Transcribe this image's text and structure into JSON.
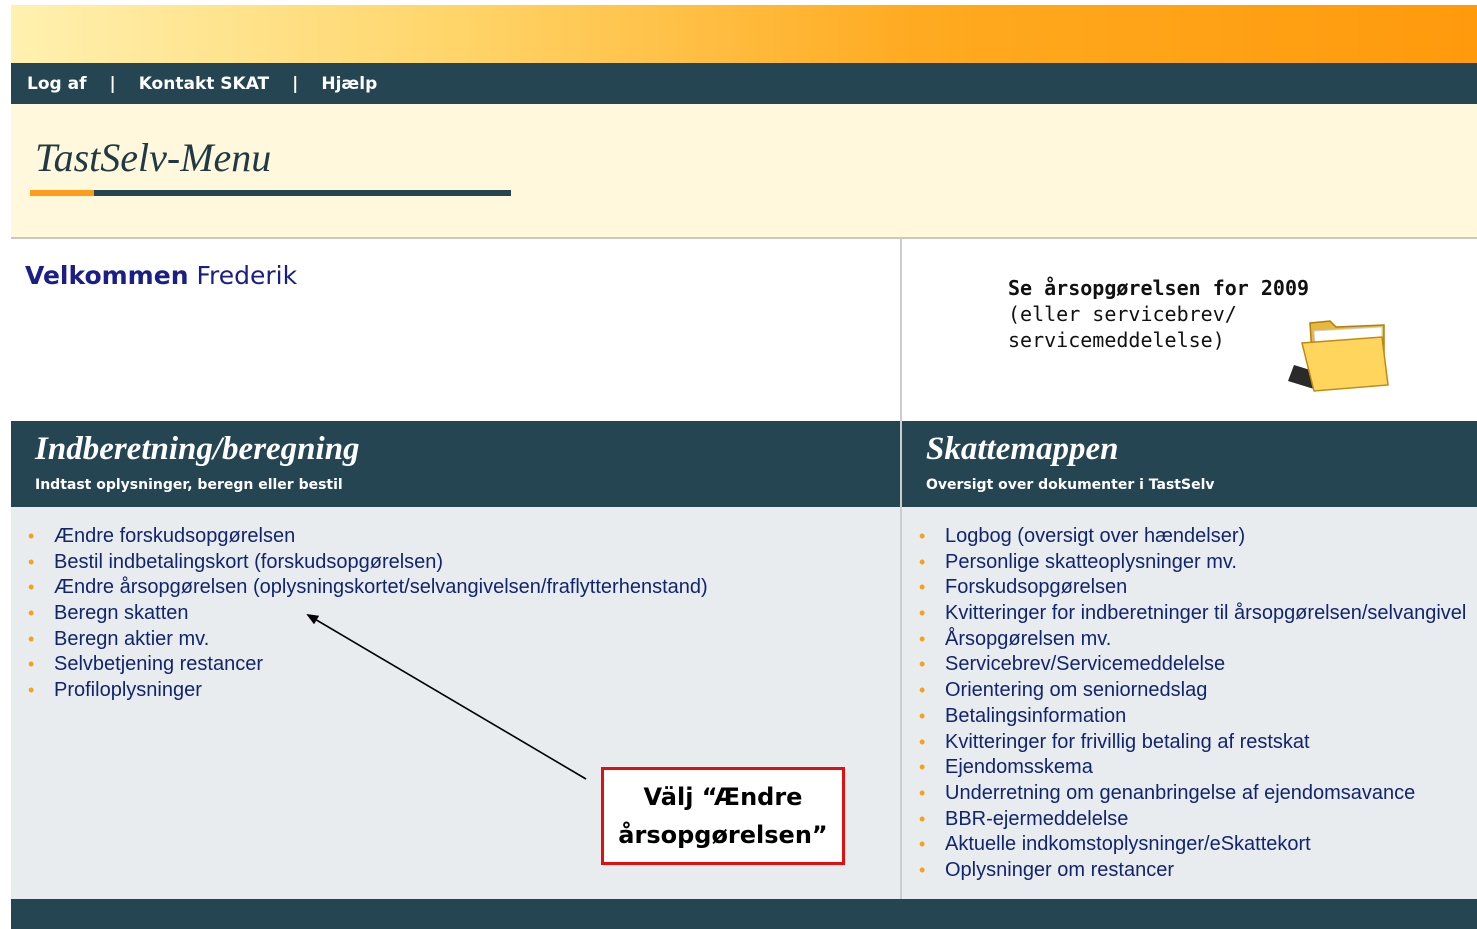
{
  "nav": {
    "logout": "Log af",
    "contact": "Kontakt SKAT",
    "help": "Hjælp",
    "separator": "|"
  },
  "header": {
    "title": "TastSelv-Menu"
  },
  "welcome": {
    "greeting": "Velkommen",
    "name": "Frederik"
  },
  "annual_statement": {
    "line1": "Se årsopgørelsen for 2009",
    "line2": "(eller servicebrev/",
    "line3": "servicemeddelelse)",
    "icon": "folder-icon"
  },
  "left_column": {
    "title": "Indberetning/beregning",
    "subtitle": "Indtast oplysninger, beregn eller bestil",
    "items": [
      "Ændre forskudsopgørelsen",
      "Bestil indbetalingskort (forskudsopgørelsen)",
      "Ændre årsopgørelsen (oplysningskortet/selvangivelsen/fraflytterhenstand)",
      "Beregn skatten",
      "Beregn aktier mv.",
      "Selvbetjening restancer",
      "Profiloplysninger"
    ]
  },
  "right_column": {
    "title": "Skattemappen",
    "subtitle": "Oversigt over dokumenter i TastSelv",
    "items": [
      "Logbog (oversigt over hændelser)",
      "Personlige skatteoplysninger mv.",
      "Forskudsopgørelsen",
      "Kvitteringer for indberetninger til årsopgørelsen/selvangivel",
      "Årsopgørelsen mv.",
      "Servicebrev/Servicemeddelelse",
      "Orientering om seniornedslag",
      "Betalingsinformation",
      "Kvitteringer for frivillig betaling af restskat",
      "Ejendomsskema",
      "Underretning om genanbringelse af ejendomsavance",
      "BBR-ejermeddelelse",
      "Aktuelle indkomstoplysninger/eSkattekort",
      "Oplysninger om restancer"
    ]
  },
  "callout": {
    "line1": "Välj “Ændre",
    "line2": "årsopgørelsen”"
  },
  "colors": {
    "dark_teal": "#254553",
    "orange": "#ff9c1a",
    "header_cream": "#fff8dc",
    "body_gray": "#e8ecef",
    "link_blue": "#11256e",
    "callout_red": "#e01010"
  }
}
